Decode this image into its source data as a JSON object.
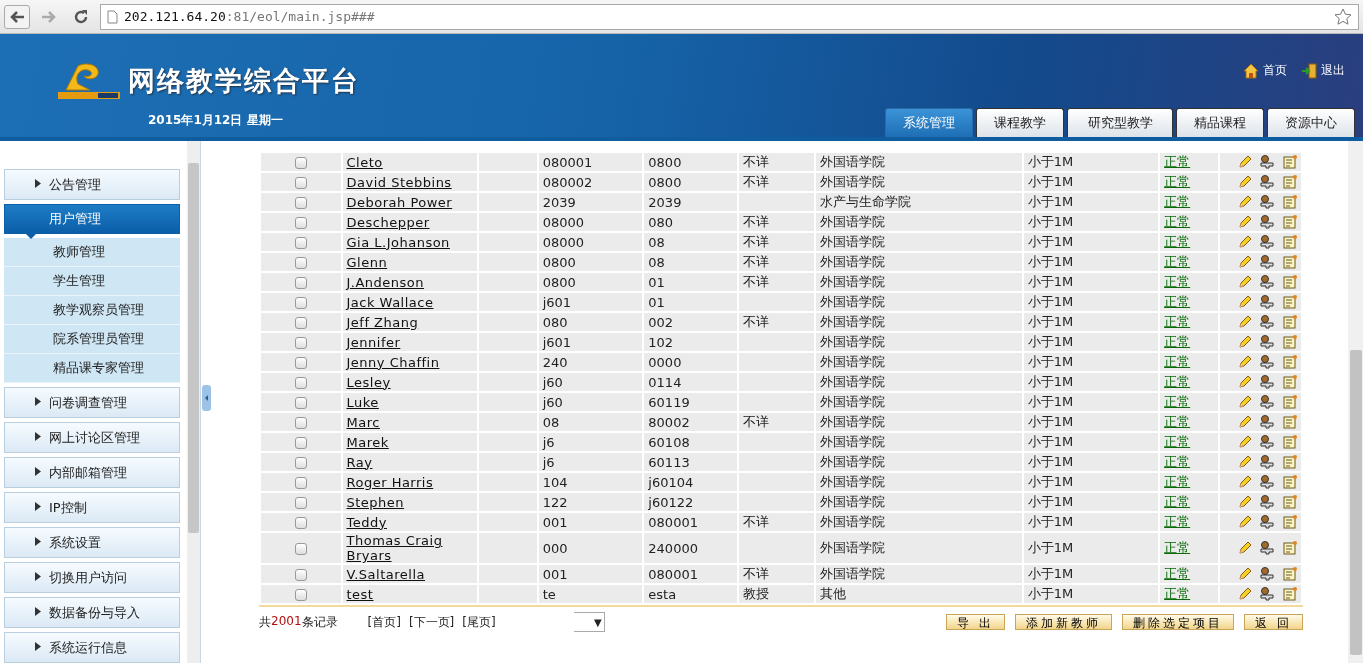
{
  "browser": {
    "url_host": "202.121.64.20",
    "url_path": ":81/eol/main.jsp###"
  },
  "header": {
    "title": "网络教学综合平台",
    "date": "2015年1月12日 星期一",
    "links": [
      "首页",
      "退出"
    ]
  },
  "tabs": [
    {
      "label": "系统管理",
      "selected": true
    },
    {
      "label": "课程教学",
      "selected": false
    },
    {
      "label": "研究型教学",
      "selected": false
    },
    {
      "label": "精品课程",
      "selected": false
    },
    {
      "label": "资源中心",
      "selected": false
    }
  ],
  "sidebar": {
    "items": [
      {
        "label": "公告管理",
        "selected": false,
        "expanded": false
      },
      {
        "label": "用户管理",
        "selected": true,
        "expanded": true,
        "children": [
          {
            "label": "教师管理"
          },
          {
            "label": "学生管理"
          },
          {
            "label": "教学观察员管理"
          },
          {
            "label": "院系管理员管理"
          },
          {
            "label": "精品课专家管理"
          }
        ]
      },
      {
        "label": "问卷调查管理",
        "selected": false,
        "expanded": false
      },
      {
        "label": "网上讨论区管理",
        "selected": false,
        "expanded": false
      },
      {
        "label": "内部邮箱管理",
        "selected": false,
        "expanded": false
      },
      {
        "label": "IP控制",
        "selected": false,
        "expanded": false
      },
      {
        "label": "系统设置",
        "selected": false,
        "expanded": false
      },
      {
        "label": "切换用户访问",
        "selected": false,
        "expanded": false
      },
      {
        "label": "数据备份与导入",
        "selected": false,
        "expanded": false
      },
      {
        "label": "系统运行信息",
        "selected": false,
        "expanded": false
      }
    ]
  },
  "table": {
    "rows": [
      {
        "checked": false,
        "name": "Cleto",
        "column_3": "080001",
        "column_4": "0800",
        "title": "不详",
        "department": "外国语学院",
        "quota": "小于1M",
        "status": "正常"
      },
      {
        "checked": false,
        "name": "David Stebbins",
        "column_3": "080002",
        "column_4": "0800",
        "title": "不详",
        "department": "外国语学院",
        "quota": "小于1M",
        "status": "正常"
      },
      {
        "checked": false,
        "name": "Deborah Power",
        "column_3": "2039",
        "column_4": "2039",
        "title": "",
        "department": "水产与生命学院",
        "quota": "小于1M",
        "status": "正常"
      },
      {
        "checked": false,
        "name": "Deschepper",
        "column_3": "08000",
        "column_4": "080",
        "title": "不详",
        "department": "外国语学院",
        "quota": "小于1M",
        "status": "正常"
      },
      {
        "checked": false,
        "name": "Gia L.Johanson",
        "column_3": "08000",
        "column_4": "08",
        "title": "不详",
        "department": "外国语学院",
        "quota": "小于1M",
        "status": "正常"
      },
      {
        "checked": false,
        "name": "Glenn",
        "column_3": "0800",
        "column_4": "08",
        "title": "不详",
        "department": "外国语学院",
        "quota": "小于1M",
        "status": "正常"
      },
      {
        "checked": false,
        "name": "J.Andenson",
        "column_3": "0800",
        "column_4": "01",
        "title": "不详",
        "department": "外国语学院",
        "quota": "小于1M",
        "status": "正常"
      },
      {
        "checked": false,
        "name": "Jack Wallace",
        "column_3": "j601",
        "column_4": "01",
        "title": "",
        "department": "外国语学院",
        "quota": "小于1M",
        "status": "正常"
      },
      {
        "checked": false,
        "name": "Jeff Zhang",
        "column_3": "080",
        "column_4": "002",
        "title": "不详",
        "department": "外国语学院",
        "quota": "小于1M",
        "status": "正常"
      },
      {
        "checked": false,
        "name": "Jennifer",
        "column_3": "j601",
        "column_4": "102",
        "title": "",
        "department": "外国语学院",
        "quota": "小于1M",
        "status": "正常"
      },
      {
        "checked": false,
        "name": "Jenny Chaffin",
        "column_3": "240",
        "column_4": "0000",
        "title": "",
        "department": "外国语学院",
        "quota": "小于1M",
        "status": "正常"
      },
      {
        "checked": false,
        "name": "Lesley",
        "column_3": "j60",
        "column_4": "0114",
        "title": "",
        "department": "外国语学院",
        "quota": "小于1M",
        "status": "正常"
      },
      {
        "checked": false,
        "name": "Luke",
        "column_3": "j60",
        "column_4": "60119",
        "title": "",
        "department": "外国语学院",
        "quota": "小于1M",
        "status": "正常"
      },
      {
        "checked": false,
        "name": "Marc",
        "column_3": "08",
        "column_4": "80002",
        "title": "不详",
        "department": "外国语学院",
        "quota": "小于1M",
        "status": "正常"
      },
      {
        "checked": false,
        "name": "Marek",
        "column_3": "j6",
        "column_4": "60108",
        "title": "",
        "department": "外国语学院",
        "quota": "小于1M",
        "status": "正常"
      },
      {
        "checked": false,
        "name": "Ray",
        "column_3": "j6",
        "column_4": "60113",
        "title": "",
        "department": "外国语学院",
        "quota": "小于1M",
        "status": "正常"
      },
      {
        "checked": false,
        "name": "Roger Harris",
        "column_3": "104",
        "column_4": "j60104",
        "title": "",
        "department": "外国语学院",
        "quota": "小于1M",
        "status": "正常"
      },
      {
        "checked": false,
        "name": "Stephen",
        "column_3": "122",
        "column_4": "j60122",
        "title": "",
        "department": "外国语学院",
        "quota": "小于1M",
        "status": "正常"
      },
      {
        "checked": false,
        "name": "Teddy",
        "column_3": "001",
        "column_4": "080001",
        "title": "不详",
        "department": "外国语学院",
        "quota": "小于1M",
        "status": "正常"
      },
      {
        "checked": false,
        "name": "Thomas Craig Bryars",
        "column_3": "000",
        "column_4": "240000",
        "title": "",
        "department": "外国语学院",
        "quota": "小于1M",
        "status": "正常"
      },
      {
        "checked": false,
        "name": "V.Saltarella",
        "column_3": "001",
        "column_4": "080001",
        "title": "不详",
        "department": "外国语学院",
        "quota": "小于1M",
        "status": "正常"
      },
      {
        "checked": false,
        "name": "test",
        "column_3": "te",
        "column_4": "esta",
        "title": "教授",
        "department": "其他",
        "quota": "小于1M",
        "status": "正常"
      }
    ]
  },
  "footer": {
    "count_prefix": "共",
    "count": "2001",
    "count_suffix": "条记录",
    "pager": [
      "[首页]",
      "[下一页]",
      "[尾页]"
    ],
    "select_caret": "▼",
    "buttons": [
      "导 出",
      "添加新教师",
      "删除选定项目",
      "返 回"
    ]
  }
}
